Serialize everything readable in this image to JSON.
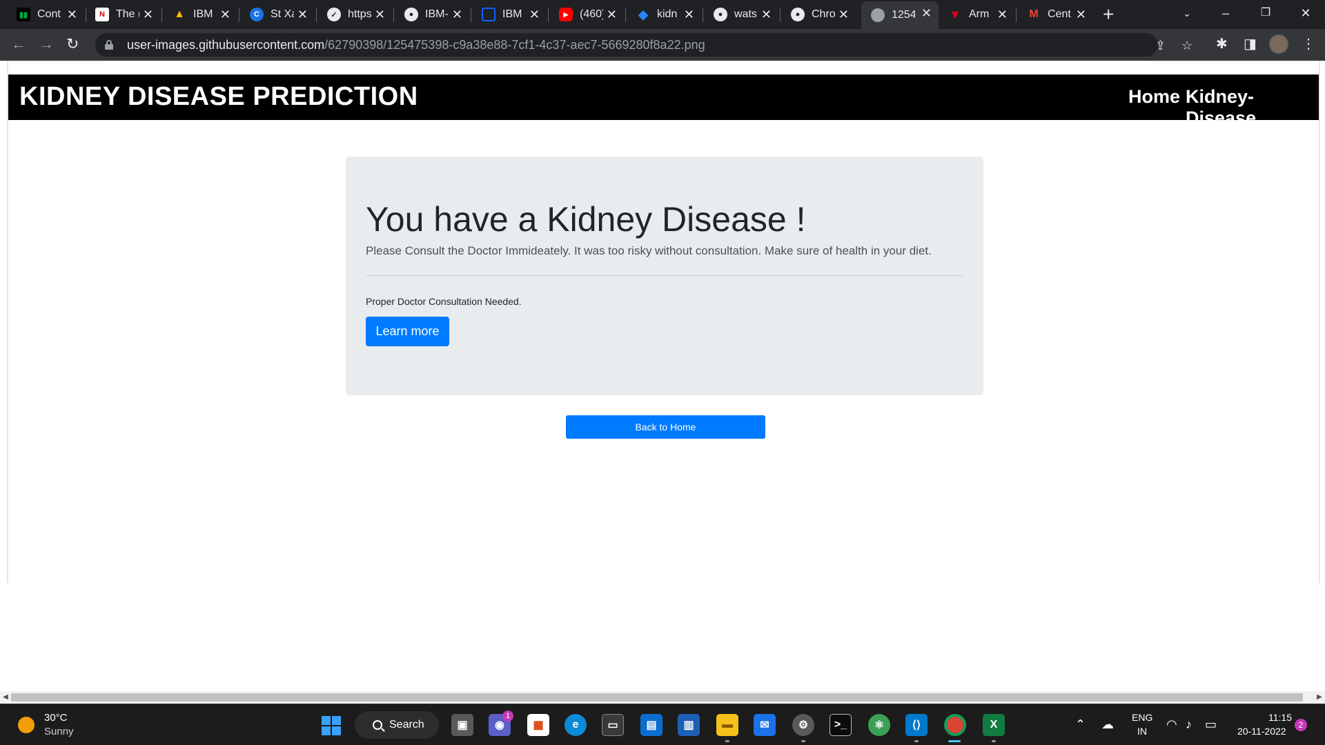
{
  "browser": {
    "tabs": [
      {
        "title": "Cont",
        "icon": "meet-icon",
        "color": "#000000"
      },
      {
        "title": "The (",
        "icon": "notes-icon",
        "color": "#ffffff"
      },
      {
        "title": "IBM (",
        "icon": "drive-icon",
        "color": "#fbbc04"
      },
      {
        "title": "St Xa",
        "icon": "c-icon",
        "color": "#1a73e8"
      },
      {
        "title": "https",
        "icon": "ext-icon",
        "color": "#e8eaed"
      },
      {
        "title": "IBM-",
        "icon": "github-icon",
        "color": "#e8eaed"
      },
      {
        "title": "IBM",
        "icon": "ibm-icon",
        "color": "#0f62fe"
      },
      {
        "title": "(460)",
        "icon": "youtube-icon",
        "color": "#ff0000"
      },
      {
        "title": "kidn",
        "icon": "jira-icon",
        "color": "#2684ff"
      },
      {
        "title": "wats",
        "icon": "github-icon",
        "color": "#e8eaed"
      },
      {
        "title": "Chro",
        "icon": "github-icon",
        "color": "#e8eaed"
      },
      {
        "title": "1254",
        "icon": "globe-icon",
        "color": "#9aa0a6",
        "active": true
      },
      {
        "title": "Arm",
        "icon": "arm-icon",
        "color": "#e0001b"
      },
      {
        "title": "Cent",
        "icon": "gmail-icon",
        "color": "#ea4335"
      }
    ],
    "url_host": "user-images.githubusercontent.com",
    "url_path": "/62790398/125475398-c9a38e88-7cf1-4c37-aec7-5669280f8a22.png"
  },
  "page": {
    "brand": "KIDNEY DISEASE PREDICTION",
    "nav": {
      "home": "Home",
      "kidney": "Kidney-Disease"
    },
    "heading": "You have a Kidney Disease !",
    "lead": "Please Consult the Doctor Immideately. It was too risky without consultation. Make sure of health in your diet.",
    "note": "Proper Doctor Consultation Needed.",
    "learn_more": "Learn more",
    "back_home": "Back to Home",
    "accent_color": "#007bff"
  },
  "taskbar": {
    "weather_temp": "30°C",
    "weather_desc": "Sunny",
    "search_label": "Search",
    "chat_badge": "1",
    "lang_line1": "ENG",
    "lang_line2": "IN",
    "time": "11:15",
    "date": "20-11-2022",
    "notifications": "2"
  }
}
